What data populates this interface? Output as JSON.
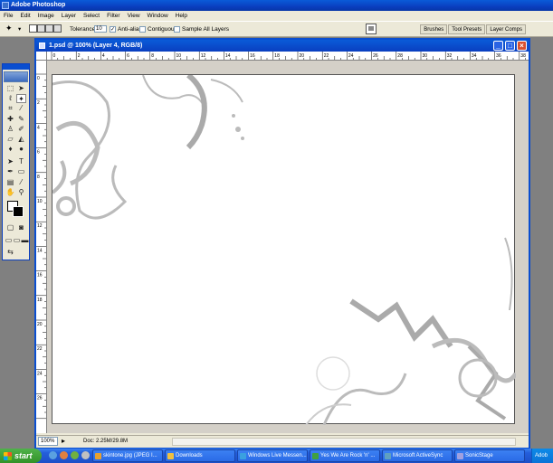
{
  "app": {
    "title": "Adobe Photoshop"
  },
  "menu": [
    "File",
    "Edit",
    "Image",
    "Layer",
    "Select",
    "Filter",
    "View",
    "Window",
    "Help"
  ],
  "options": {
    "tolerance_label": "Tolerance:",
    "tolerance_value": "10",
    "anti_alias": "Anti-alias",
    "contiguous": "Contiguous",
    "sample_all_layers": "Sample All Layers"
  },
  "palette_tabs": [
    "Brushes",
    "Tool Presets",
    "Layer Comps"
  ],
  "document": {
    "title": "1.psd @ 100% (Layer 4, RGB/8)",
    "zoom": "100%",
    "doc_size": "Doc: 2.25M/29.8M",
    "ruler_labels": [
      "0",
      "2",
      "4",
      "6",
      "8",
      "10",
      "12",
      "14",
      "16",
      "18",
      "20",
      "22",
      "24",
      "26",
      "28",
      "30",
      "32",
      "34",
      "36",
      "38"
    ],
    "ruler_v_labels": [
      "0",
      "2",
      "4",
      "6",
      "8",
      "10",
      "12",
      "14",
      "16",
      "18",
      "20",
      "22",
      "24",
      "26"
    ]
  },
  "taskbar": {
    "start_label": "start",
    "tasks": [
      {
        "label": "skintone.jpg (JPEG I...",
        "color": "#e8a030"
      },
      {
        "label": "Downloads",
        "color": "#f0c040"
      },
      {
        "label": "Windows Live Messen...",
        "color": "#3aa0e0"
      },
      {
        "label": "Yes We Are Rock 'n' ...",
        "color": "#40a040"
      },
      {
        "label": "Microsoft ActiveSync",
        "color": "#60a0c0"
      },
      {
        "label": "SonicStage",
        "color": "#a0a0e0"
      }
    ],
    "tray_label": "Adob"
  }
}
